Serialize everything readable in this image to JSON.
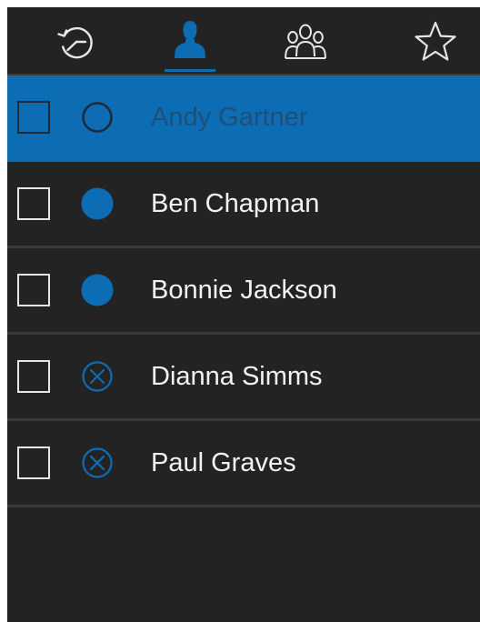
{
  "tabs": [
    {
      "id": "recent",
      "icon": "history-icon"
    },
    {
      "id": "contacts",
      "icon": "person-icon",
      "active": true
    },
    {
      "id": "groups",
      "icon": "group-icon"
    },
    {
      "id": "favorites",
      "icon": "star-icon"
    }
  ],
  "contacts": [
    {
      "name": "Andy Gartner",
      "status": "offline-outline",
      "selected": true
    },
    {
      "name": "Ben Chapman",
      "status": "online"
    },
    {
      "name": "Bonnie Jackson",
      "status": "online"
    },
    {
      "name": "Dianna Simms",
      "status": "unavailable"
    },
    {
      "name": "Paul Graves",
      "status": "unavailable"
    }
  ],
  "colors": {
    "background": "#232323",
    "accent": "#0c6db5",
    "divider": "#3a3a3a",
    "text": "#f2f2f2"
  }
}
